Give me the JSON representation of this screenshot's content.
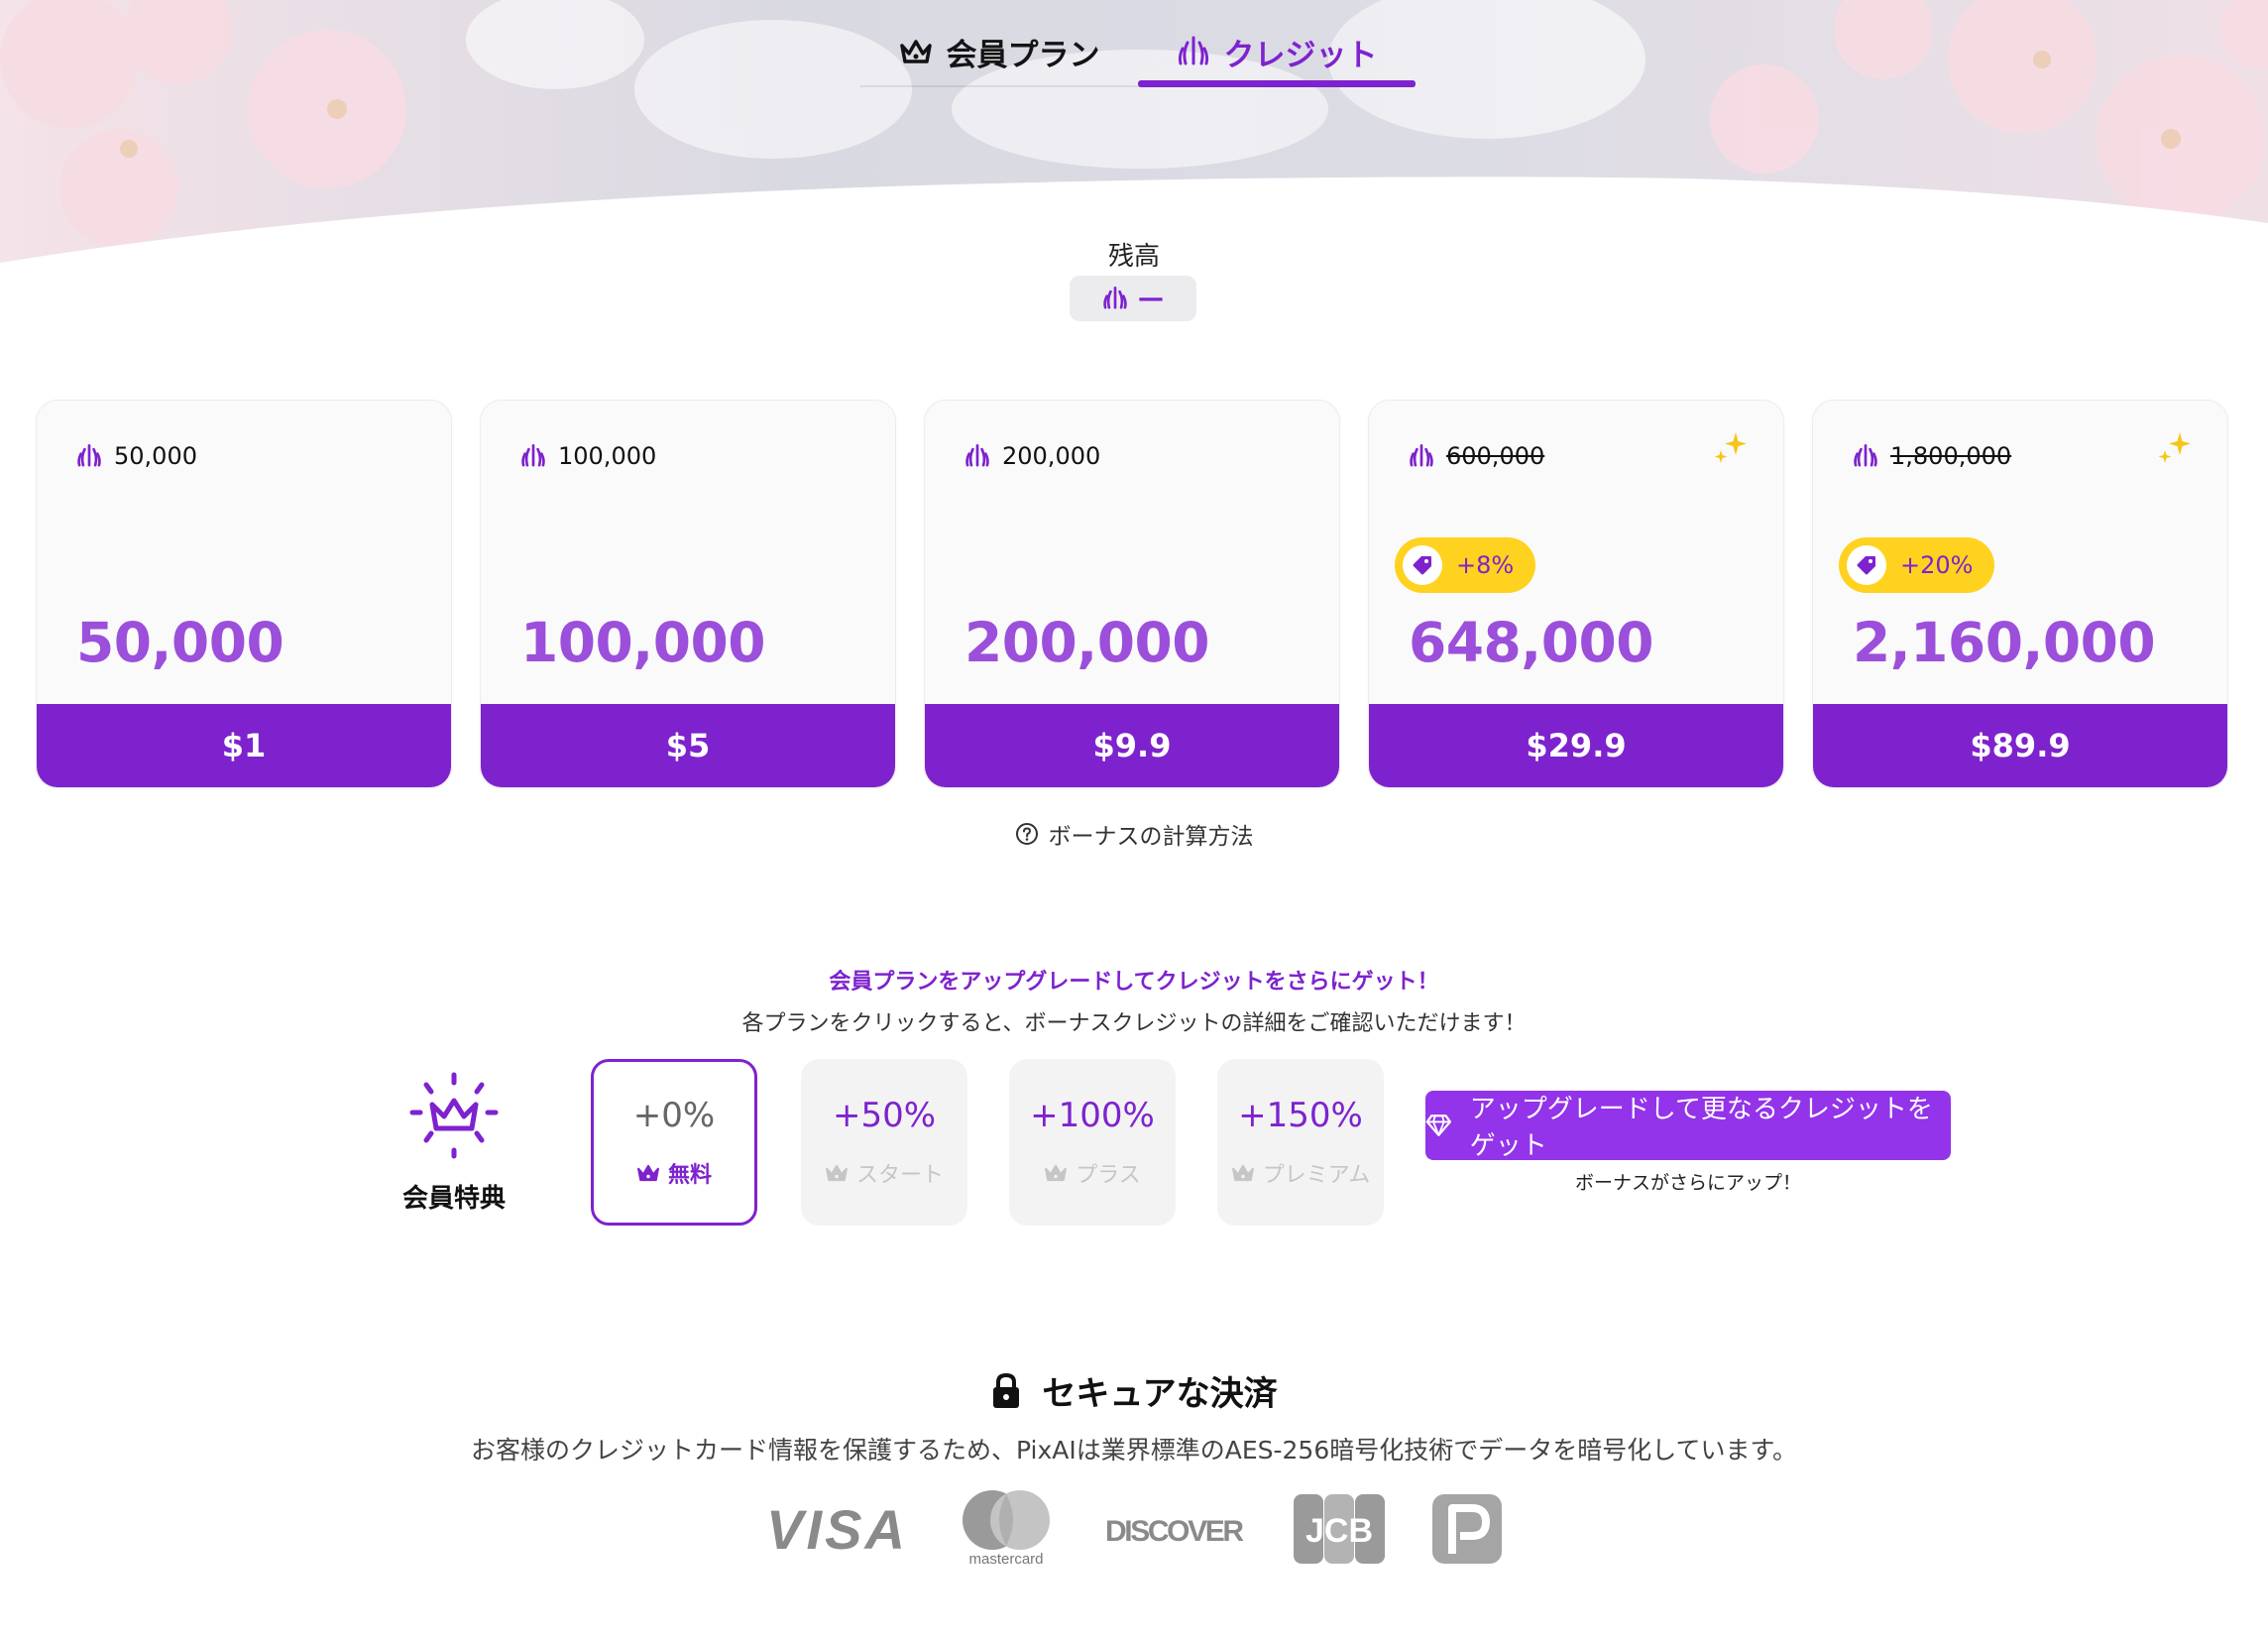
{
  "tabs": [
    {
      "label": "会員プラン",
      "icon": "crown-icon",
      "active": false
    },
    {
      "label": "クレジット",
      "icon": "credit-icon",
      "active": true
    }
  ],
  "balance": {
    "label": "残高",
    "value": "—"
  },
  "packages": [
    {
      "amount": "50,000",
      "base_struck": false,
      "bonus": "",
      "total": "50,000",
      "price": "$1"
    },
    {
      "amount": "100,000",
      "base_struck": false,
      "bonus": "",
      "total": "100,000",
      "price": "$5"
    },
    {
      "amount": "200,000",
      "base_struck": false,
      "bonus": "",
      "total": "200,000",
      "price": "$9.9"
    },
    {
      "amount": "600,000",
      "base_struck": true,
      "bonus": "+8%",
      "total": "648,000",
      "price": "$29.9"
    },
    {
      "amount": "1,800,000",
      "base_struck": true,
      "bonus": "+20%",
      "total": "2,160,000",
      "price": "$89.9"
    }
  ],
  "bonus_calc_link": "ボーナスの計算方法",
  "membership": {
    "title": "会員プランをアップグレードしてクレジットをさらにゲット！",
    "subtitle": "各プランをクリックすると、ボーナスクレジットの詳細をご確認いただけます！",
    "perk_label": "会員特典",
    "tiers": [
      {
        "pct": "+0%",
        "name": "無料",
        "selected": true
      },
      {
        "pct": "+50%",
        "name": "スタート",
        "selected": false
      },
      {
        "pct": "+100%",
        "name": "プラス",
        "selected": false
      },
      {
        "pct": "+150%",
        "name": "プレミアム",
        "selected": false
      }
    ],
    "upgrade_button": "アップグレードして更なるクレジットをゲット",
    "upgrade_note": "ボーナスがさらにアップ！"
  },
  "secure": {
    "title": "セキュアな決済",
    "description": "お客様のクレジットカード情報を保護するため、PixAIは業界標準のAES-256暗号化技術でデータを暗号化しています。",
    "logos": [
      "VISA",
      "mastercard",
      "DISCOVER",
      "JCB",
      "PayPay"
    ]
  },
  "colors": {
    "accent": "#7e22ce",
    "accent_light": "#9b4fdb",
    "badge": "#ffd21f",
    "button": "#9333ea"
  }
}
